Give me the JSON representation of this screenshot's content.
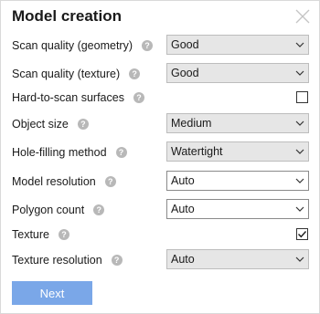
{
  "dialog": {
    "title": "Model creation",
    "next_label": "Next"
  },
  "fields": [
    {
      "label": "Scan quality (geometry)",
      "value": "Good"
    },
    {
      "label": "Scan quality (texture)",
      "value": "Good"
    },
    {
      "label": "Hard-to-scan surfaces",
      "checked": false
    },
    {
      "label": "Object size",
      "value": "Medium"
    },
    {
      "label": "Hole-filling method",
      "value": "Watertight"
    },
    {
      "label": "Model resolution",
      "value": "Auto"
    },
    {
      "label": "Polygon count",
      "value": "Auto"
    },
    {
      "label": "Texture",
      "checked": true
    },
    {
      "label": "Texture resolution",
      "value": "Auto"
    }
  ],
  "help_glyph": "?",
  "icons": {
    "close": "close-icon",
    "chevron": "chevron-down-icon",
    "help": "help-icon",
    "check": "checkmark-icon"
  },
  "colors": {
    "primary_button": "#7aa7e8",
    "select_background": "#e6e6e6"
  }
}
